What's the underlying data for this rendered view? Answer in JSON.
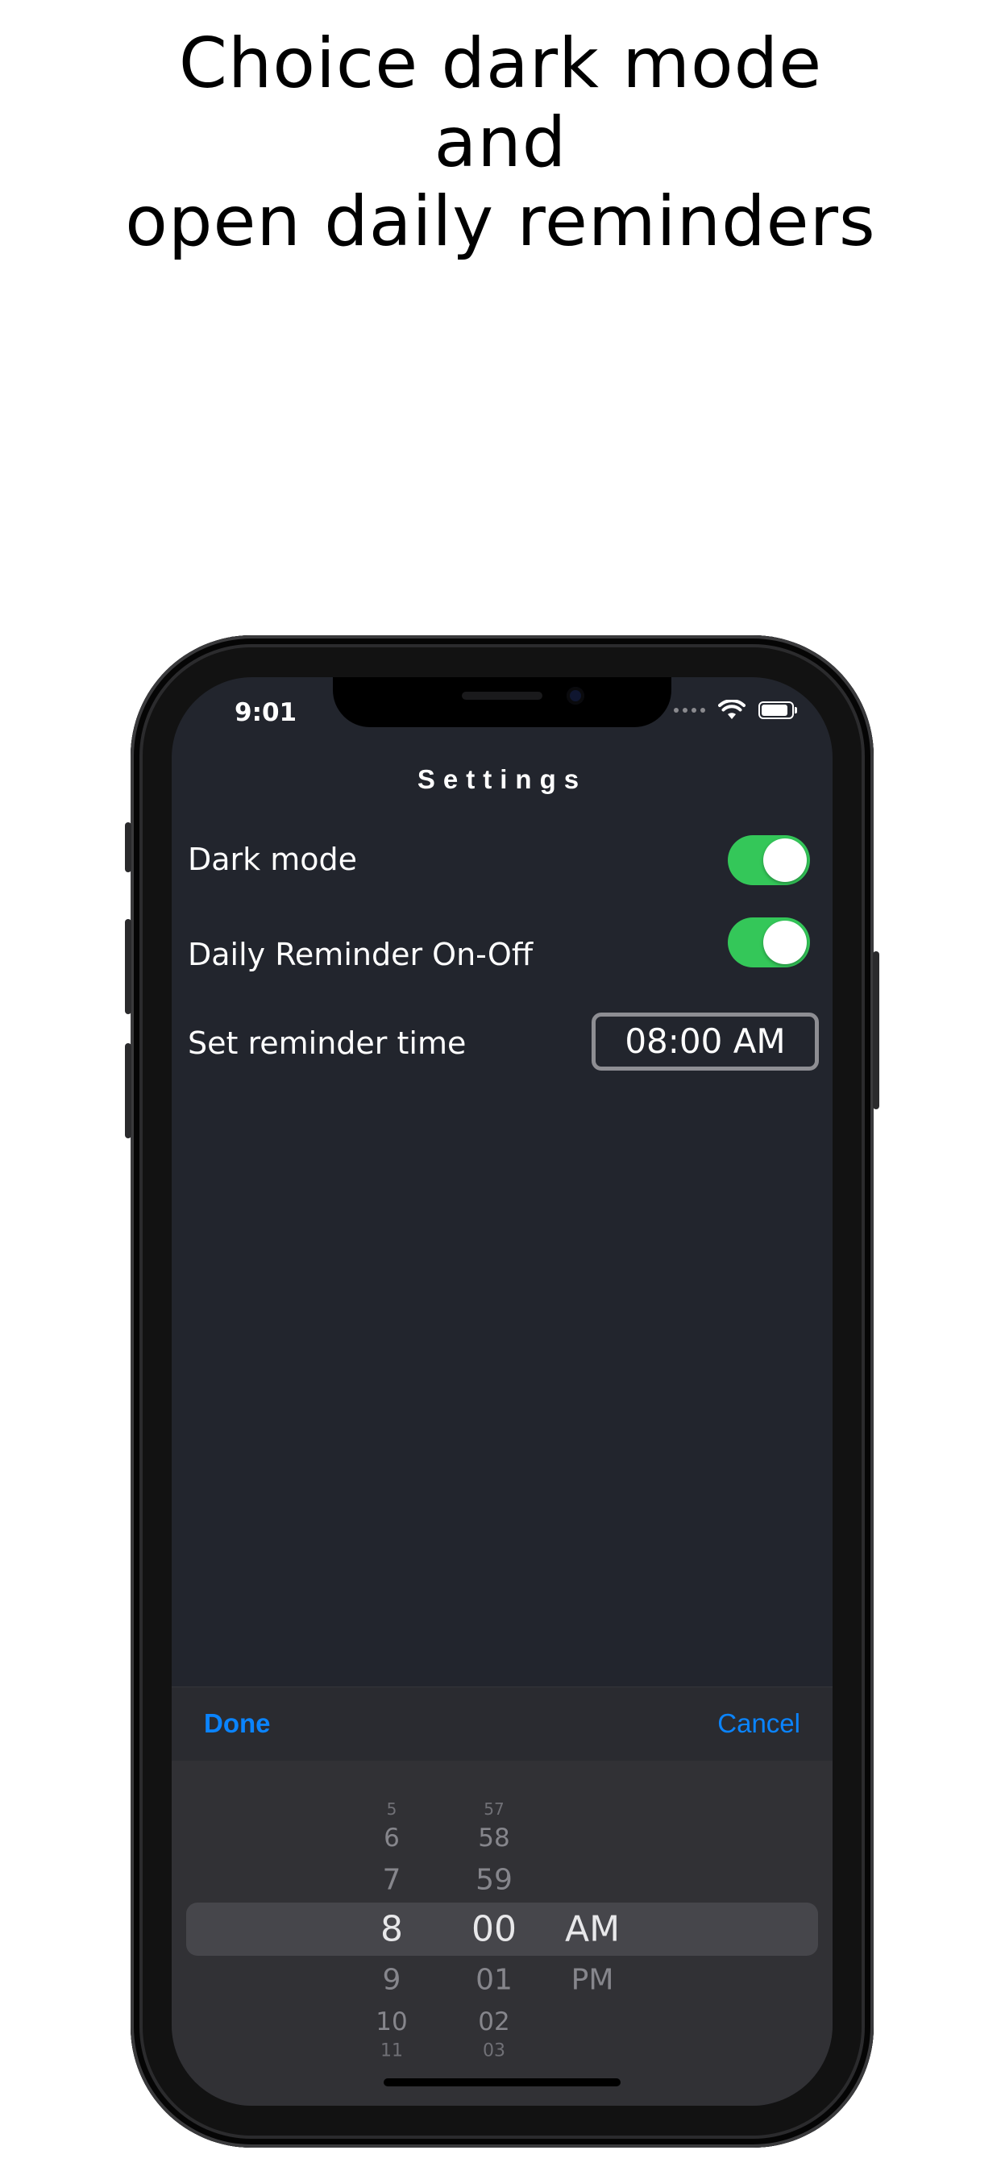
{
  "headline": {
    "line1": "Choice dark mode",
    "line2": "and",
    "line3": "open daily reminders"
  },
  "status_bar": {
    "time": "9:01"
  },
  "settings": {
    "title": "Settings",
    "dark_mode_label": "Dark mode",
    "dark_mode_on": true,
    "reminder_label": "Daily Reminder On-Off",
    "reminder_on": true,
    "reminder_time_label": "Set reminder time",
    "reminder_time_value": "08:00 AM"
  },
  "picker_toolbar": {
    "done_label": "Done",
    "cancel_label": "Cancel"
  },
  "time_picker": {
    "hours": [
      "5",
      "6",
      "7",
      "8",
      "9",
      "10",
      "11"
    ],
    "minutes": [
      "57",
      "58",
      "59",
      "00",
      "01",
      "02",
      "03"
    ],
    "periods": [
      "AM",
      "PM"
    ],
    "selected": {
      "hour": "8",
      "minute": "00",
      "period": "AM"
    }
  },
  "colors": {
    "screen_bg": "#22252d",
    "toggle_on": "#34c759",
    "accent_blue": "#0a84ff"
  }
}
